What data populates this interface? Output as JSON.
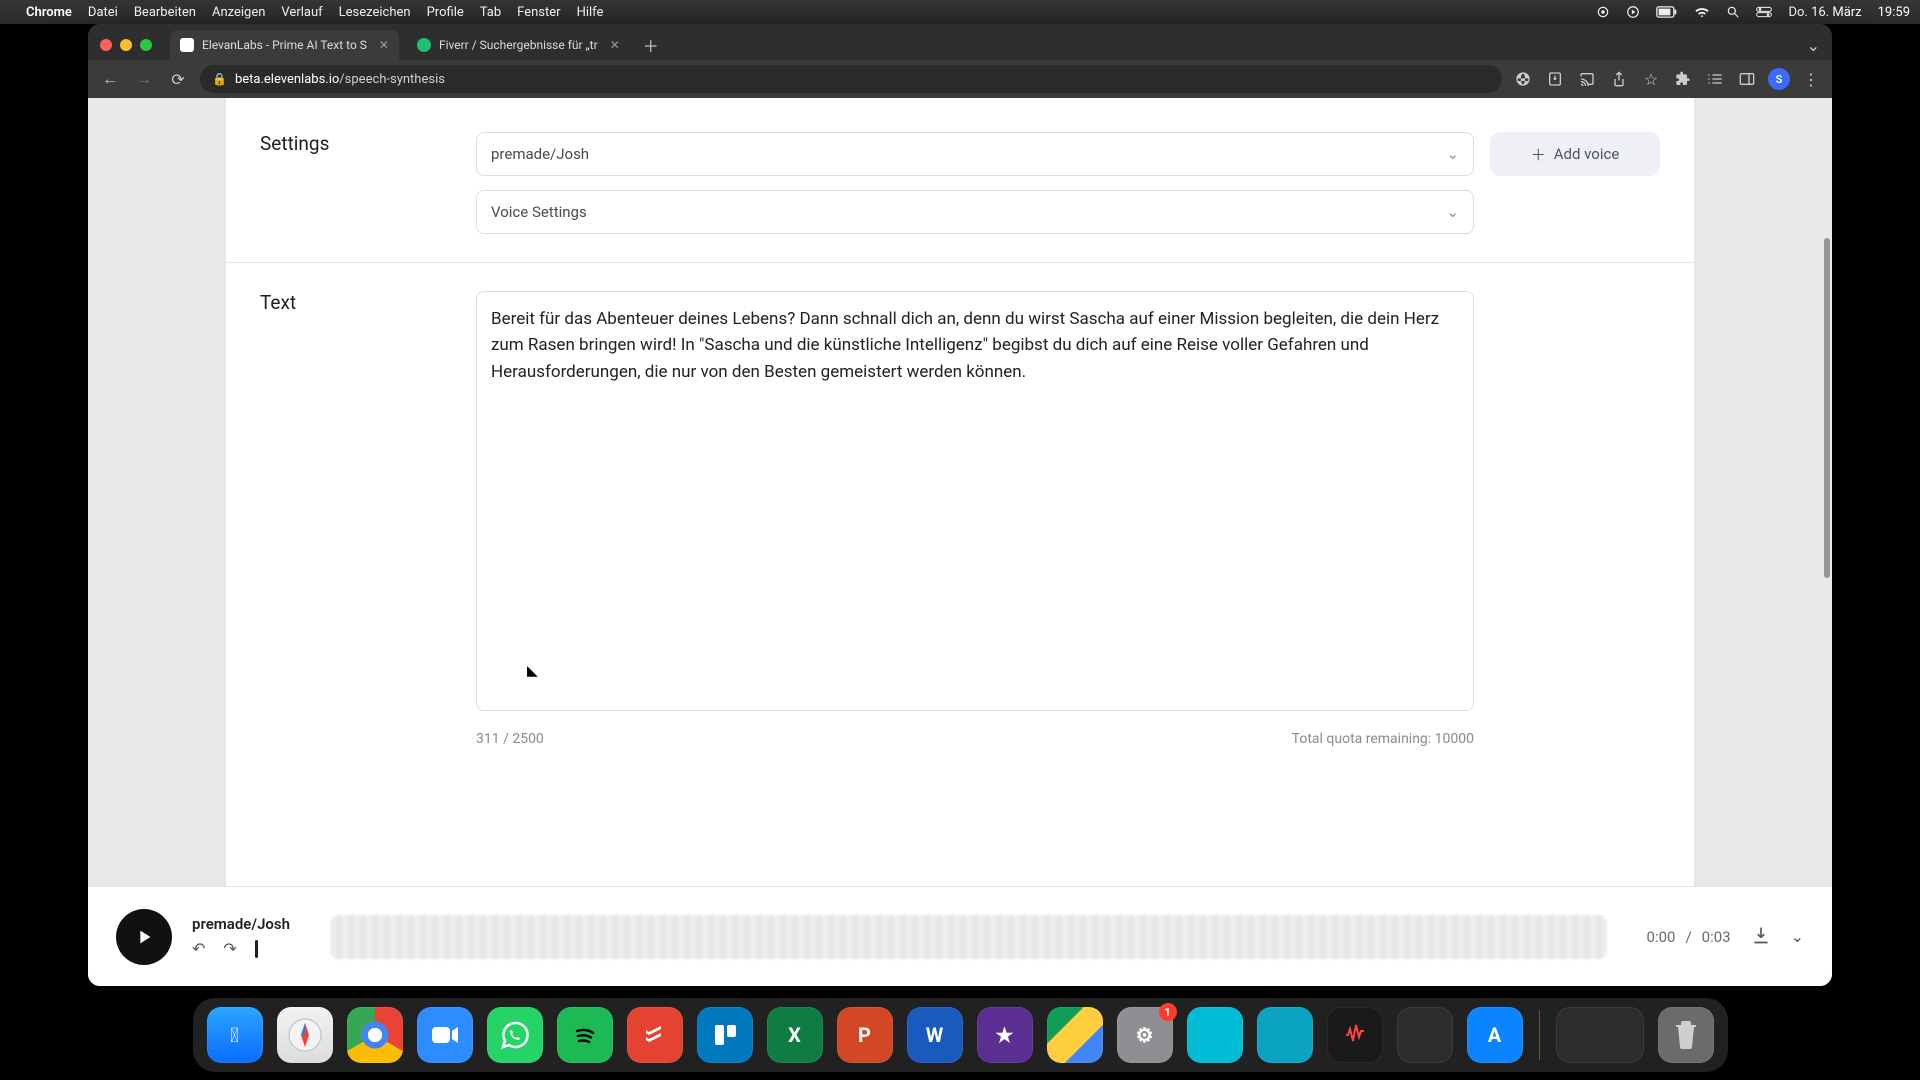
{
  "menubar": {
    "app": "Chrome",
    "items": [
      "Datei",
      "Bearbeiten",
      "Anzeigen",
      "Verlauf",
      "Lesezeichen",
      "Profile",
      "Tab",
      "Fenster",
      "Hilfe"
    ],
    "date": "Do. 16. März",
    "time": "19:59"
  },
  "chrome": {
    "tabs": [
      {
        "title": "ElevanLabs - Prime AI Text to S",
        "active": true,
        "favicon": "el"
      },
      {
        "title": "Fiverr / Suchergebnisse für „tr",
        "active": false,
        "favicon": "fi"
      }
    ],
    "url_host": "beta.elevenlabs.io",
    "url_path": "/speech-synthesis",
    "avatar_initial": "S"
  },
  "page": {
    "settings_label": "Settings",
    "voice_name": "premade/Josh",
    "voice_settings_label": "Voice Settings",
    "add_voice_label": "Add voice",
    "text_label": "Text",
    "text_value": "Bereit für das Abenteuer deines Lebens? Dann schnall dich an, denn du wirst Sascha auf einer Mission begleiten, die dein Herz zum Rasen bringen wird! In \"Sascha und die künstliche Intelligenz\" begibst du dich auf eine Reise voller Gefahren und Herausforderungen, die nur von den Besten gemeistert werden können.",
    "char_count": "311 / 2500",
    "quota": "Total quota remaining: 10000"
  },
  "player": {
    "title": "premade/Josh",
    "current": "0:00",
    "duration": "0:03"
  },
  "dock": {
    "apps": [
      "Finder",
      "Safari",
      "Chrome",
      "Zoom",
      "WhatsApp",
      "Spotify",
      "Todoist",
      "Trello",
      "Excel",
      "PowerPoint",
      "Word",
      "iMovie",
      "Google Drive",
      "Systemeinstellungen",
      "App",
      "QuickTime",
      "Sprachmemos",
      "",
      "App Store"
    ],
    "settings_badge": "1"
  }
}
